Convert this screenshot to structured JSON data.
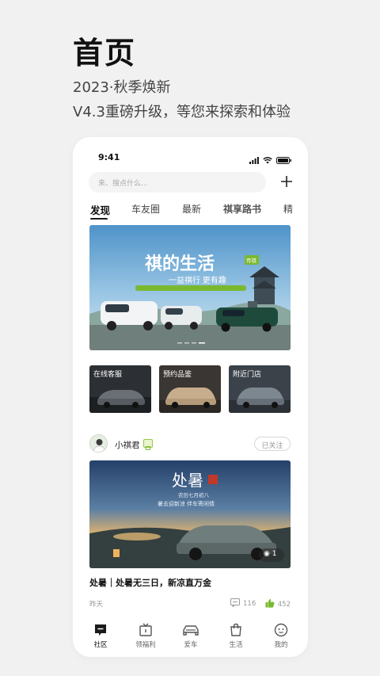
{
  "promo": {
    "title": "首页",
    "subtitle1": "2023·秋季焕新",
    "subtitle2": "V4.3重磅升级，等您来探索和体验"
  },
  "status": {
    "time": "9:41"
  },
  "search": {
    "placeholder": "来、搜点什么..."
  },
  "tabs": [
    {
      "label": "发现",
      "active": true
    },
    {
      "label": "车友圈"
    },
    {
      "label": "最新"
    },
    {
      "label": "祺享路书"
    },
    {
      "label": "精"
    }
  ],
  "banner": {
    "headline": "祺的生活",
    "tagline": "一益祺行 更有趣",
    "tag": "传祺"
  },
  "quick_links": [
    {
      "label": "在线客服"
    },
    {
      "label": "预约品鉴"
    },
    {
      "label": "附近门店"
    }
  ],
  "post": {
    "author": "小祺君",
    "follow_label": "已关注",
    "image_title": "处暑",
    "image_date": "农历七月初八",
    "image_caption": "暑去迎新凉 伴车寄闲情",
    "photo_count": "1",
    "title": "处暑｜处暑无三日，新凉直万金",
    "time": "昨天",
    "comments": "116",
    "likes": "452"
  },
  "nav": [
    {
      "label": "社区",
      "icon": "community-icon",
      "active": true
    },
    {
      "label": "领福利",
      "icon": "gift-icon"
    },
    {
      "label": "爱车",
      "icon": "car-icon"
    },
    {
      "label": "生活",
      "icon": "shopping-bag-icon"
    },
    {
      "label": "我的",
      "icon": "profile-face-icon"
    }
  ],
  "colors": {
    "accent_green": "#7ab82f",
    "page_bg": "#f1f1f1",
    "card_bg": "#ffffff"
  }
}
